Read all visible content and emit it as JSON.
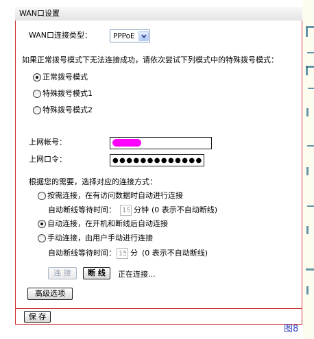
{
  "header": {
    "title": "WAN口设置"
  },
  "wan_type": {
    "label": "WAN口连接类型：",
    "selected": "PPPoE"
  },
  "dial_mode": {
    "hint": "如果正常拨号模式下无法连接成功，请依次尝试下列模式中的特殊拨号模式：",
    "options": [
      {
        "label": "正常拨号模式",
        "checked": true
      },
      {
        "label": "特殊拨号模式1",
        "checked": false
      },
      {
        "label": "特殊拨号模式2",
        "checked": false
      }
    ]
  },
  "account": {
    "label": "上网帐号："
  },
  "password": {
    "label": "上网口令：",
    "value": "●●●●●●●●●●●●●●"
  },
  "connection": {
    "hint": "根据您的需要，选择对应的连接方式：",
    "options": [
      {
        "label": "按需连接，在有访问数据时自动进行连接",
        "checked": false
      },
      {
        "label": "自动连接，在开机和断线后自动连接",
        "checked": true
      },
      {
        "label": "手动连接，由用户手动进行连接",
        "checked": false
      }
    ],
    "on_demand_idle": {
      "label": "自动断线等待时间：",
      "value": "15",
      "unit": "分钟",
      "note": "(0 表示不自动断线)"
    },
    "manual_idle": {
      "label": "自动断线等待时间：",
      "value": "15",
      "unit": "分",
      "note": "(0 表示不自动断线)"
    }
  },
  "actions": {
    "connect_label": "连 接",
    "disconnect_label": "断 线",
    "status": "正在连接..."
  },
  "advanced_label": "高级选项",
  "save_label": "保 存",
  "figure_label": "图8",
  "icons": {
    "select_arrow": "chevron-down-icon"
  },
  "colors": {
    "panel_border": "#cc3333",
    "figure_label": "#2b3fbf",
    "redaction": "#ff00ff"
  }
}
